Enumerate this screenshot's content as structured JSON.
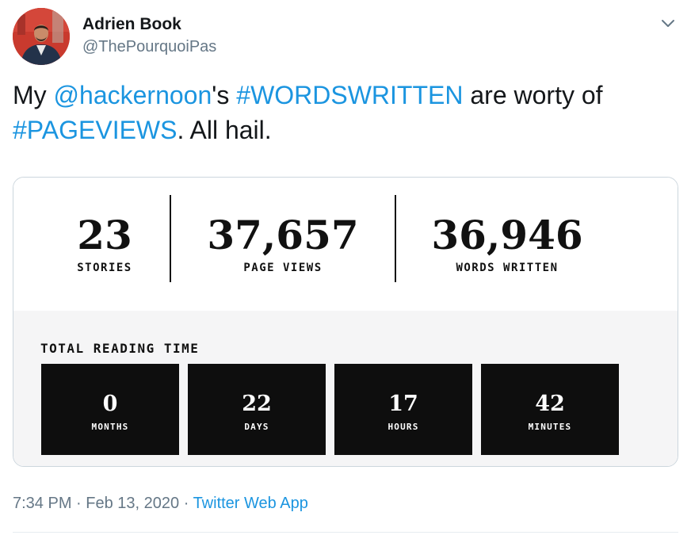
{
  "tweet": {
    "author": {
      "name": "Adrien Book",
      "handle": "@ThePourquoiPas"
    },
    "menu_icon": "chevron-down-icon",
    "text": {
      "t1": "My ",
      "mention": "@hackernoon",
      "t2": "'s ",
      "hashtag1": "#WORDSWRITTEN",
      "t3": " are worty of ",
      "hashtag2": "#PAGEVIEWS",
      "t4": ". All hail."
    },
    "footer": {
      "time": "7:34 PM",
      "sep1": " · ",
      "date": "Feb 13, 2020",
      "sep2": " · ",
      "app": "Twitter Web App"
    }
  },
  "card": {
    "stats": [
      {
        "value": "23",
        "label": "STORIES"
      },
      {
        "value": "37,657",
        "label": "PAGE VIEWS"
      },
      {
        "value": "36,946",
        "label": "WORDS WRITTEN"
      }
    ],
    "reading_time": {
      "title": "TOTAL READING TIME",
      "units": [
        {
          "value": "0",
          "label": "MONTHS"
        },
        {
          "value": "22",
          "label": "DAYS"
        },
        {
          "value": "17",
          "label": "HOURS"
        },
        {
          "value": "42",
          "label": "MINUTES"
        }
      ]
    }
  },
  "colors": {
    "link": "#1b95e0",
    "muted": "#657786",
    "text": "#14171a",
    "card_dark": "#0e0e0e",
    "card_light": "#f5f5f6",
    "avatar_bg": "#c93a2e"
  }
}
